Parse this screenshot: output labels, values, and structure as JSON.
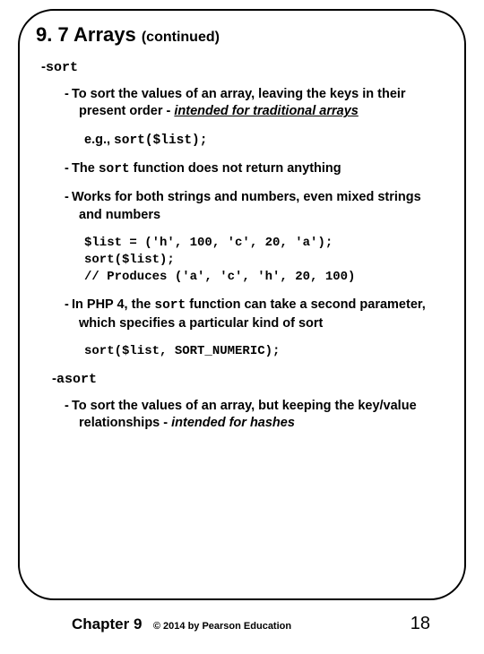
{
  "heading": {
    "number": "9. 7",
    "title": "Arrays",
    "suffix": "(continued)"
  },
  "items": {
    "sort_label": "sort",
    "sort_desc_pre": "To sort the values of an array, leaving the keys in their present order - ",
    "sort_desc_em": "intended for traditional arrays",
    "eg_label": "e.g., ",
    "eg_code": "sort($list);",
    "no_return_pre": "The ",
    "no_return_mono": "sort",
    "no_return_post": " function does not return anything",
    "works_both": "Works for both strings and numbers, even mixed strings and numbers",
    "code_block": "$list = ('h', 100, 'c', 20, 'a');\nsort($list);\n// Produces ('a', 'c', 'h', 20, 100)",
    "php4_pre": "In PHP 4, the ",
    "php4_mono": "sort",
    "php4_post": " function can take a second parameter, which specifies a particular kind of sort",
    "numeric_code": "sort($list, SORT_NUMERIC);",
    "asort_label": "asort",
    "asort_desc_pre": "To sort the values of an array, but keeping the key/value relationships - ",
    "asort_desc_em": "intended for hashes"
  },
  "footer": {
    "chapter": "Chapter 9",
    "copy": "© 2014 by Pearson Education",
    "page": "18"
  }
}
